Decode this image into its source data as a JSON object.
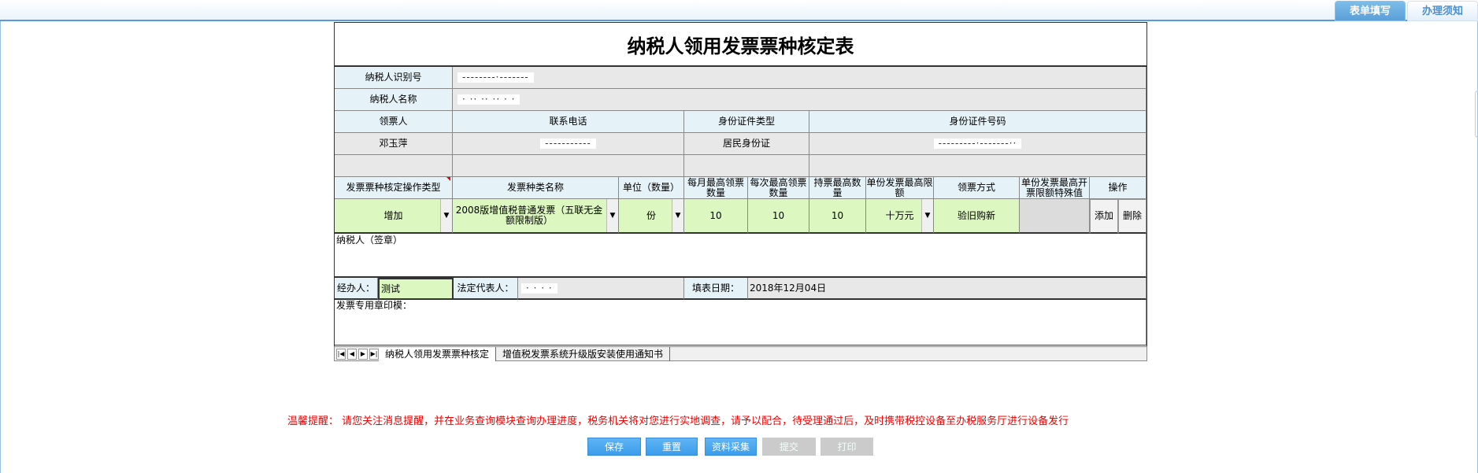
{
  "tabs": [
    {
      "label": "表单填写",
      "active": true
    },
    {
      "label": "办理须知",
      "active": false
    }
  ],
  "form": {
    "title": "纳税人领用发票票种核定表",
    "taxpayer_id_label": "纳税人识别号",
    "taxpayer_id_value": "--------·-------",
    "taxpayer_name_label": "纳税人名称",
    "taxpayer_name_value": "· ·· ·· ·· · ·",
    "receiver_label": "领票人",
    "phone_label": "联系电话",
    "id_type_label": "身份证件类型",
    "id_number_label": "身份证件号码",
    "receiver_value": "邓玉萍",
    "phone_value": "-----------",
    "id_type_value": "居民身份证",
    "id_number_value": "---------·-------··",
    "columns": [
      "发票票种核定操作类型",
      "发票种类名称",
      "单位（数量）",
      "每月最高领票数量",
      "每次最高领票数量",
      "持票最高数量",
      "单份发票最高限额",
      "领票方式",
      "单份发票最高开票限额特殊值",
      "操作"
    ],
    "row": {
      "op_type": "增加",
      "invoice_type": "2008版增值税普通发票（五联无金额限制版）",
      "unit": "份",
      "monthly_max": "10",
      "each_max": "10",
      "hold_max": "10",
      "limit": "十万元",
      "method": "验旧购新",
      "special": "",
      "add": "添加",
      "delete": "删除"
    },
    "signature_label": "纳税人（签章）",
    "handler_label": "经办人：",
    "handler_value": "测试",
    "legal_rep_label": "法定代表人：",
    "legal_rep_value": "· · · ·",
    "date_label": "填表日期：",
    "date_value": "2018年12月04日",
    "seal_label": "发票专用章印模："
  },
  "sheet_tabs": [
    "纳税人领用发票票种核定",
    "增值税发票系统升级版安装使用通知书"
  ],
  "notice": "温馨提醒： 请您关注消息提醒，并在业务查询模块查询办理进度，税务机关将对您进行实地调查，请予以配合，待受理通过后，及时携带税控设备至办税服务厅进行设备发行",
  "buttons": [
    {
      "label": "保存",
      "enabled": true
    },
    {
      "label": "重置",
      "enabled": true
    },
    {
      "label": "资料采集",
      "enabled": true
    },
    {
      "label": "提交",
      "enabled": false
    },
    {
      "label": "打印",
      "enabled": false
    }
  ]
}
